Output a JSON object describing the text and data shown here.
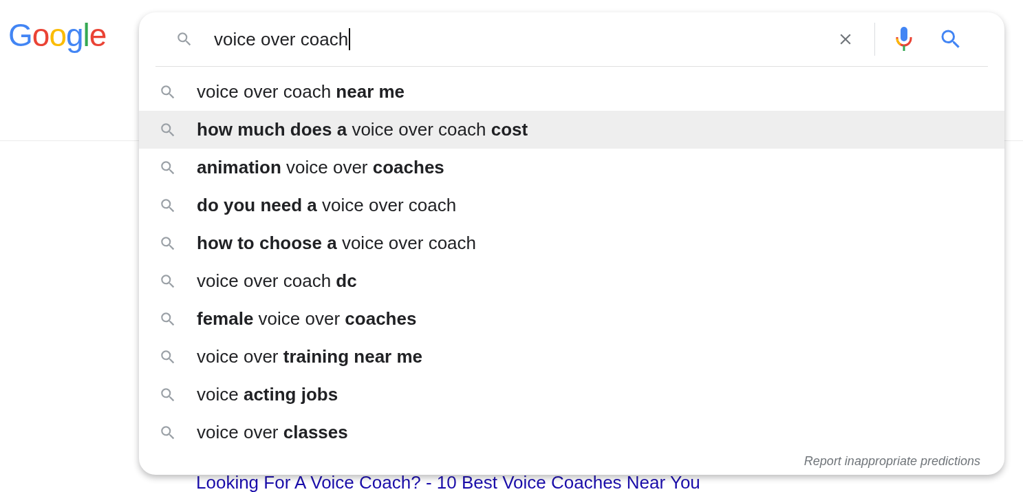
{
  "logo": "Google",
  "search": {
    "value": "voice over coach"
  },
  "suggestions": [
    {
      "text": "voice over coach **near me**",
      "selected": false
    },
    {
      "text": "**how much does a** voice over coach **cost**",
      "selected": true
    },
    {
      "text": "**animation** voice over **coaches**",
      "selected": false
    },
    {
      "text": "**do you need a** voice over coach",
      "selected": false
    },
    {
      "text": "**how to choose a** voice over coach",
      "selected": false
    },
    {
      "text": "voice over coach **dc**",
      "selected": false
    },
    {
      "text": "**female** voice over **coaches**",
      "selected": false
    },
    {
      "text": "voice over **training near me**",
      "selected": false
    },
    {
      "text": "voice **acting jobs**",
      "selected": false
    },
    {
      "text": "voice over **classes**",
      "selected": false
    }
  ],
  "report_link": "Report inappropriate predictions",
  "result_title": "Looking For A Voice Coach? - 10 Best Voice Coaches Near You"
}
